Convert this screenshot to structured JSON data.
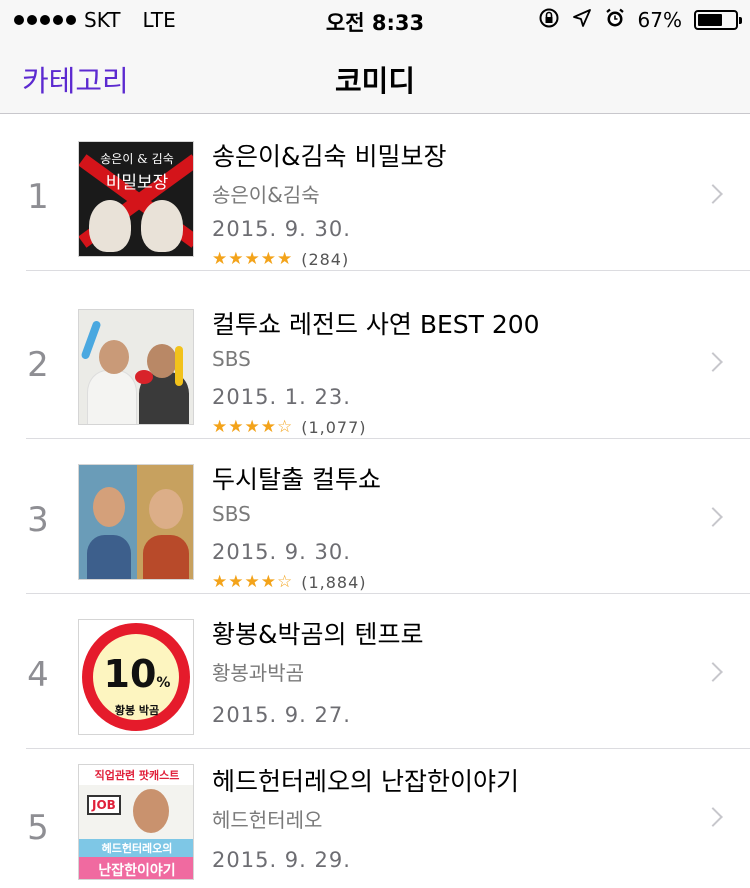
{
  "status_bar": {
    "carrier": "SKT",
    "network": "LTE",
    "time": "오전 8:33",
    "battery_percent": "67%",
    "battery_level": 0.67,
    "icons": [
      "rotation-lock-icon",
      "location-icon",
      "alarm-icon",
      "battery-icon"
    ]
  },
  "nav": {
    "back_label": "카테고리",
    "title": "코미디",
    "accent_color": "#5c2ad0"
  },
  "items": [
    {
      "rank": "1",
      "title": "송은이&김숙 비밀보장",
      "author": "송은이&김숙",
      "date": "2015. 9. 30.",
      "stars": "★★★★★",
      "rating_count": "(284)",
      "art_text_top": "송은이 & 김숙",
      "art_text_main": "비밀보장"
    },
    {
      "rank": "2",
      "title": "컬투쇼 레전드 사연 BEST 200",
      "author": "SBS",
      "date": "2015. 1. 23.",
      "stars": "★★★★☆",
      "rating_count": "(1,077)"
    },
    {
      "rank": "3",
      "title": "두시탈출 컬투쇼",
      "author": "SBS",
      "date": "2015. 9. 30.",
      "stars": "★★★★☆",
      "rating_count": "(1,884)"
    },
    {
      "rank": "4",
      "title": "황봉&박곰의 텐프로",
      "author": "황봉과박곰",
      "date": "2015. 9. 27.",
      "art_number": "10",
      "art_percent": "%",
      "art_label": "황봉 박곰"
    },
    {
      "rank": "5",
      "title": "헤드헌터레오의 난잡한이야기",
      "author": "헤드헌터레오",
      "date": "2015. 9. 29.",
      "art_top": "직업관련 팟캐스트",
      "art_job": "JOB",
      "art_sub": "헤드헌터레오의",
      "art_main": "난잡한이야기"
    }
  ]
}
